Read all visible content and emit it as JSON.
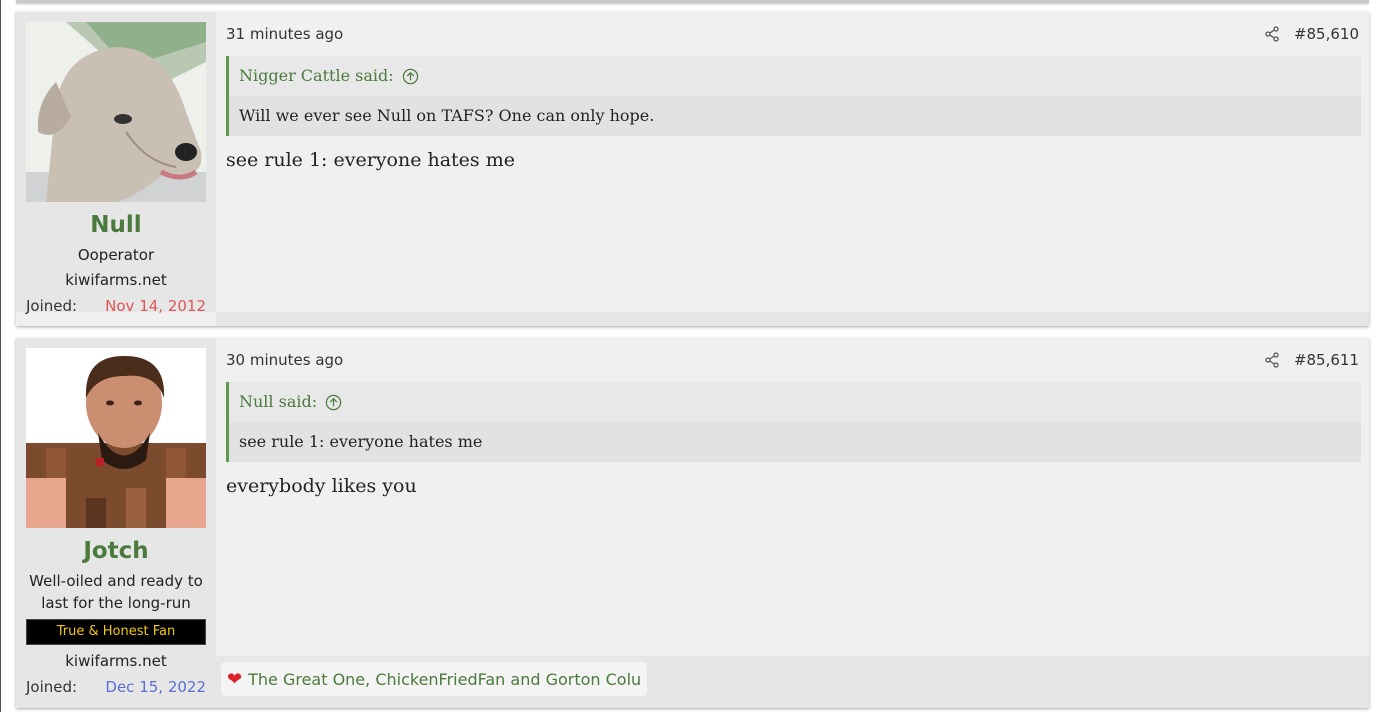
{
  "posts": [
    {
      "time": "31 minutes ago",
      "post_number": "#85,610",
      "username": "Null",
      "title_lines": [
        "Ooperator"
      ],
      "site": "kiwifarms.net",
      "joined_label": "Joined:",
      "joined_date": "Nov 14, 2012",
      "joined_color": "#e05555",
      "quote_author": "Nigger Cattle said:",
      "quote_text": "Will we ever see Null on TAFS? One can only hope.",
      "message": "see rule 1: everyone hates me",
      "avatar_icon": "dog-avatar"
    },
    {
      "time": "30 minutes ago",
      "post_number": "#85,611",
      "username": "Jotch",
      "title_lines": [
        "Well-oiled and ready to",
        "last for the long-run"
      ],
      "banner": "True & Honest Fan",
      "site": "kiwifarms.net",
      "joined_label": "Joined:",
      "joined_date": "Dec 15, 2022",
      "joined_color": "#5a6fd6",
      "quote_author": "Null said:",
      "quote_text": "see rule 1: everyone hates me",
      "message": "everybody likes you",
      "reactions": "The Great One, ChickenFriedFan and Gorton Colu",
      "avatar_icon": "person-avatar"
    }
  ],
  "icons": {
    "share": "share-icon",
    "quote_jump": "arrow-up-circle-icon",
    "reaction": "heart-icon"
  },
  "colors": {
    "username": "#4a7a3c",
    "quote_border": "#5e9a4e",
    "banner_text": "#f1c80c"
  }
}
